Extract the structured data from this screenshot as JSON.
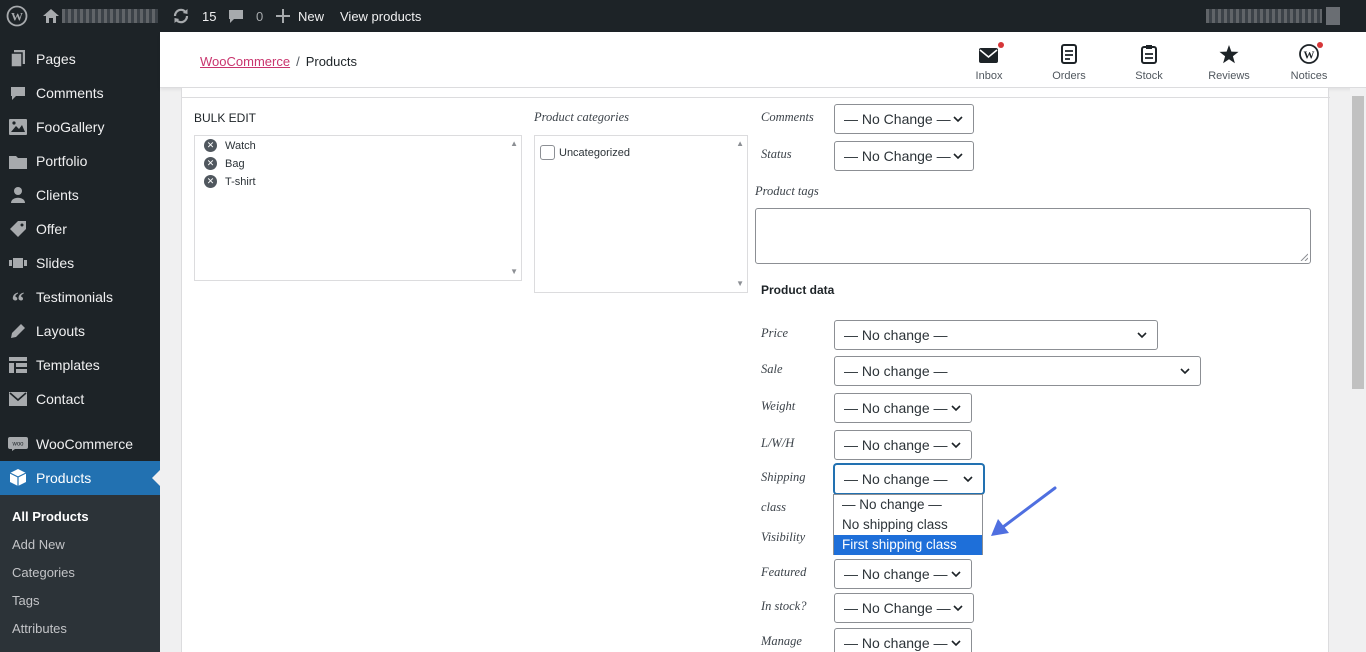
{
  "adminbar": {
    "updates_count": "15",
    "comments_count": "0",
    "new_label": "New",
    "view_label": "View products"
  },
  "sidebar": {
    "items": [
      {
        "label": "Pages",
        "icon": "pages-icon"
      },
      {
        "label": "Comments",
        "icon": "comments-icon"
      },
      {
        "label": "FooGallery",
        "icon": "gallery-icon"
      },
      {
        "label": "Portfolio",
        "icon": "folder-icon"
      },
      {
        "label": "Clients",
        "icon": "user-icon"
      },
      {
        "label": "Offer",
        "icon": "tag-icon"
      },
      {
        "label": "Slides",
        "icon": "slides-icon"
      },
      {
        "label": "Testimonials",
        "icon": "quote-icon"
      },
      {
        "label": "Layouts",
        "icon": "pen-icon"
      },
      {
        "label": "Templates",
        "icon": "templates-icon"
      },
      {
        "label": "Contact",
        "icon": "mail-icon"
      },
      {
        "label": "WooCommerce",
        "icon": "woo-icon"
      },
      {
        "label": "Products",
        "icon": "box-icon",
        "active": true
      }
    ],
    "submenu": [
      "All Products",
      "Add New",
      "Categories",
      "Tags",
      "Attributes"
    ]
  },
  "header": {
    "breadcrumb_link": "WooCommerce",
    "breadcrumb_sep": "/",
    "breadcrumb_current": "Products",
    "icons": [
      {
        "label": "Inbox",
        "icon": "inbox-icon"
      },
      {
        "label": "Orders",
        "icon": "orders-icon"
      },
      {
        "label": "Stock",
        "icon": "stock-icon"
      },
      {
        "label": "Reviews",
        "icon": "star-icon"
      },
      {
        "label": "Notices",
        "icon": "wordpress-icon"
      }
    ]
  },
  "bulk_edit": {
    "title": "BULK EDIT",
    "items": [
      "Watch",
      "Bag",
      "T-shirt"
    ],
    "categories_title": "Product categories",
    "categories": [
      "Uncategorized"
    ]
  },
  "fields": {
    "comments_label": "Comments",
    "comments_value": "— No Change —",
    "status_label": "Status",
    "status_value": "— No Change —",
    "tags_label": "Product tags",
    "product_data_title": "Product data",
    "price_label": "Price",
    "price_value": "— No change —",
    "sale_label": "Sale",
    "sale_value": "— No change —",
    "weight_label": "Weight",
    "weight_value": "— No change —",
    "lwh_label": "L/W/H",
    "lwh_value": "— No change —",
    "shipping_label_1": "Shipping",
    "shipping_label_2": "class",
    "shipping_value": "— No change —",
    "visibility_label": "Visibility",
    "featured_label": "Featured",
    "featured_value": "— No change —",
    "instock_label": "In stock?",
    "instock_value": "— No Change —",
    "manage_label": "Manage",
    "manage_value": "— No change —"
  },
  "shipping_dropdown": {
    "options": [
      "— No change —",
      "No shipping class",
      "First shipping class"
    ],
    "highlighted_index": 2
  },
  "colors": {
    "accent": "#2271b1",
    "highlight": "#1e6fd9",
    "link": "#c9356e",
    "arrow": "#4f6fe0"
  }
}
